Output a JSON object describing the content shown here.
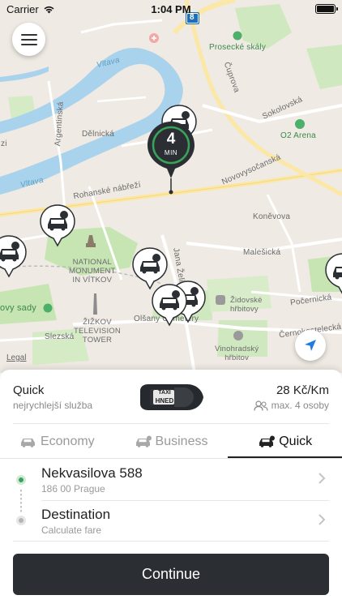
{
  "status_bar": {
    "carrier": "Carrier",
    "time": "1:04 PM"
  },
  "map": {
    "route_badge": "8",
    "labels": {
      "prosecke_skaly": "Prosecké skály",
      "vltava_top": "Vltava",
      "cuprova": "Čuprova",
      "argentinska": "Argentinská",
      "delnicka": "Dělnická",
      "sokolovska": "Sokolovská",
      "o2_arena": "O2 Arena",
      "novovysocanska": "Novovysočanská",
      "rohanske_nabrezi": "Rohanské nábřeží",
      "vltava_left": "Vltava",
      "konevova": "Koněvova",
      "malesicka": "Malešická",
      "national_monument": "NATIONAL\nMONUMENT\nIN VÍTKOV",
      "jana_zelivskeho": "Jana Želivského",
      "zidovske_hrbitovy": "Židovské\nhřbitovy",
      "pocernicka": "Počernická",
      "riegrovy_sady": "ovy sady",
      "zizkov_tower": "ŽIŽKOV\nTELEVISION\nTOWER",
      "olsany_cemetery": "Olšany Cemetery",
      "slezska": "Slezská",
      "cernokostelecka": "Černokostelecká",
      "vinohradsky_hrbitov": "Vinohradský\nhřbitov",
      "edge_left": "zi"
    },
    "legal": "Legal",
    "eta": {
      "value": "4",
      "unit": "MIN"
    }
  },
  "summary": {
    "service_name": "Quick",
    "service_desc": "nejrychlejší služba",
    "car_sign_line1": "TAXI",
    "car_sign_line2": "HNED",
    "price": "28 Kč/Km",
    "capacity": "max. 4 osoby"
  },
  "tabs": [
    {
      "label": "Economy",
      "icon": "taxi-car-icon",
      "active": false
    },
    {
      "label": "Business",
      "icon": "taxi-car-business-icon",
      "active": false
    },
    {
      "label": "Quick",
      "icon": "taxi-car-quick-icon",
      "active": true
    }
  ],
  "route": {
    "pickup_title": "Nekvasilova 588",
    "pickup_sub": "186 00 Prague",
    "destination_title": "Destination",
    "destination_sub": "Calculate fare"
  },
  "continue_label": "Continue",
  "colors": {
    "accent_green": "#3aa35a",
    "button_dark": "#2b2e33",
    "map_water": "#a9d3ec",
    "map_park": "#c7e5b3"
  }
}
